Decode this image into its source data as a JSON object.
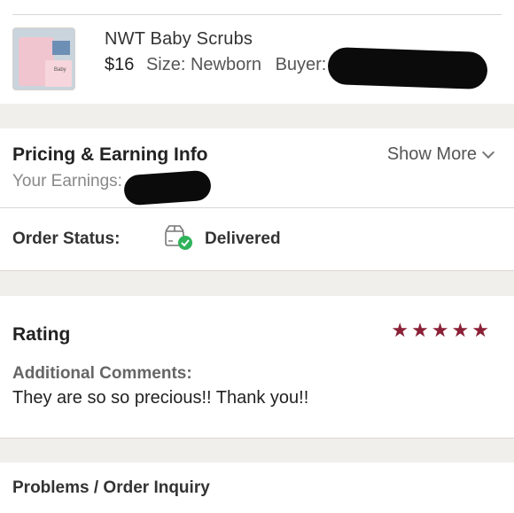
{
  "item": {
    "title": "NWT Baby Scrubs",
    "price": "$16",
    "size_text": "Size: Newborn",
    "buyer_label": "Buyer:",
    "thumb_text": "Baby"
  },
  "pricing": {
    "title": "Pricing & Earning Info",
    "show_more": "Show More",
    "earnings_label": "Your Earnings:"
  },
  "order_status": {
    "label": "Order Status:",
    "value": "Delivered",
    "icon": "delivered-box-icon"
  },
  "rating": {
    "title": "Rating",
    "stars": 5,
    "comments_label": "Additional Comments:",
    "comments_text": "They are so so precious!! Thank you!!"
  },
  "problems": {
    "label": "Problems / Order Inquiry"
  },
  "colors": {
    "star": "#8a2036",
    "check": "#2fb35a",
    "background": "#f1efec"
  }
}
